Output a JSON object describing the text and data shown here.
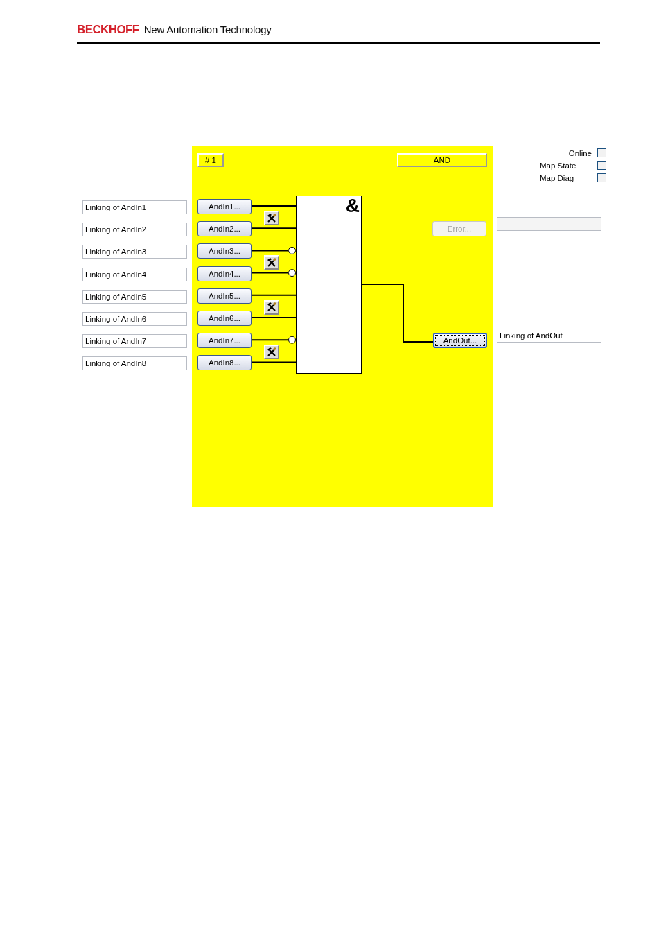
{
  "header": {
    "brand": "BECKHOFF",
    "tagline": "New Automation Technology"
  },
  "block": {
    "number": "# 1",
    "type": "AND",
    "gate_symbol": "&"
  },
  "options": [
    {
      "label": "Online",
      "checked": false
    },
    {
      "label": "Map State",
      "checked": false
    },
    {
      "label": "Map Diag",
      "checked": false
    }
  ],
  "inputs": [
    {
      "link": "Linking of AndIn1",
      "button": "AndIn1...",
      "negated": false
    },
    {
      "link": "Linking of AndIn2",
      "button": "AndIn2...",
      "negated": false
    },
    {
      "link": "Linking of AndIn3",
      "button": "AndIn3...",
      "negated": true
    },
    {
      "link": "Linking of AndIn4",
      "button": "AndIn4...",
      "negated": true
    },
    {
      "link": "Linking of AndIn5",
      "button": "AndIn5...",
      "negated": false
    },
    {
      "link": "Linking of AndIn6",
      "button": "AndIn6...",
      "negated": false
    },
    {
      "link": "Linking of AndIn7",
      "button": "AndIn7...",
      "negated": true
    },
    {
      "link": "Linking of AndIn8",
      "button": "AndIn8...",
      "negated": false
    }
  ],
  "error_button": {
    "label": "Error...",
    "disabled": true
  },
  "output": {
    "button": "AndOut...",
    "focused": true,
    "link": "Linking of AndOut"
  }
}
